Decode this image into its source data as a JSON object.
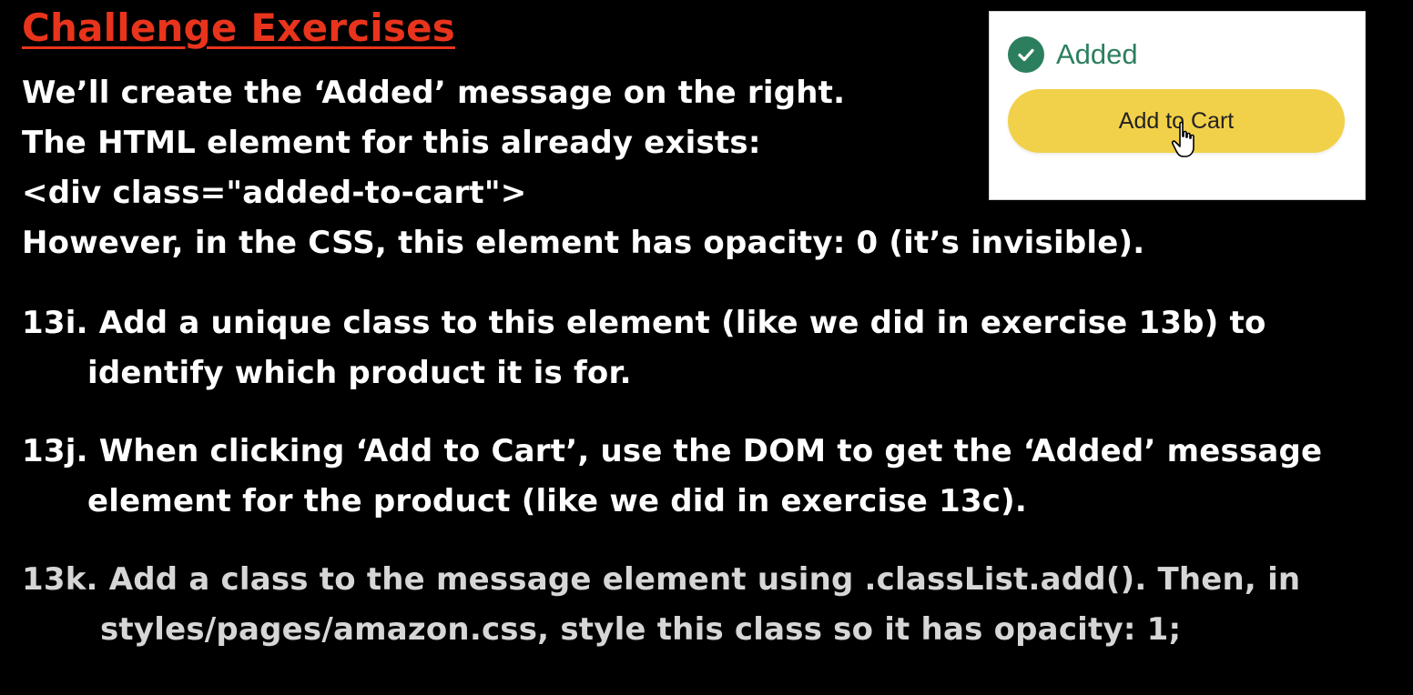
{
  "title": "Challenge Exercises",
  "intro": {
    "line1": "We’ll create the ‘Added’ message on the right.",
    "line2": "The HTML element for this already exists:",
    "line3": "<div class=\"added-to-cart\">",
    "line4": "However, in the CSS, this element has opacity: 0 (it’s invisible)."
  },
  "exercises": [
    {
      "number": "13i.",
      "line1": "Add a unique class to this element (like we did in exercise 13b) to",
      "line2": "identify which product it is for."
    },
    {
      "number": "13j.",
      "line1": "When clicking ‘Add to Cart’, use the DOM to get the ‘Added’ message",
      "line2": "element for the product (like we did in exercise 13c)."
    },
    {
      "number": "13k.",
      "line1": "Add a class to the message element using .classList.add(). Then, in",
      "line2": "styles/pages/amazon.css, style this class so it has opacity: 1;"
    }
  ],
  "preview": {
    "added_label": "Added",
    "button_label": "Add to Cart",
    "icons": {
      "check": "check-circle-icon",
      "cursor": "hand-pointer-icon"
    }
  },
  "colors": {
    "title": "#e8341c",
    "added_green": "#2c7f5e",
    "button_yellow": "#f2d14a",
    "background": "#000000",
    "text": "#ffffff"
  }
}
